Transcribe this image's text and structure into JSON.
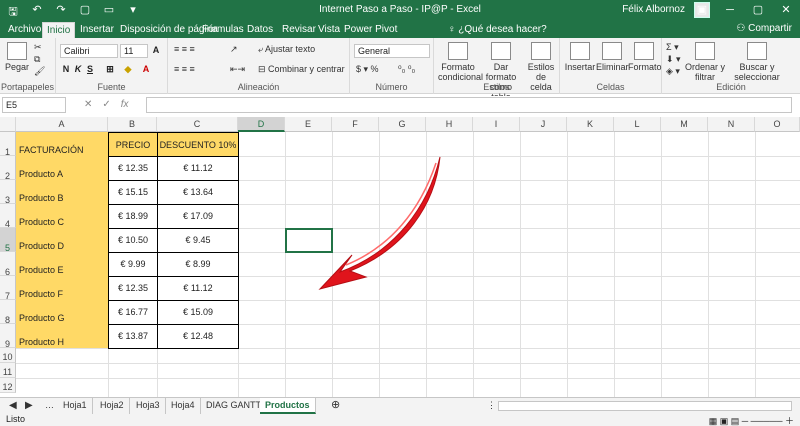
{
  "titlebar": {
    "title": "Internet Paso a Paso - IP@P  -  Excel",
    "user": "Félix Albornoz"
  },
  "tabs": [
    "Archivo",
    "Inicio",
    "Insertar",
    "Disposición de página",
    "Fórmulas",
    "Datos",
    "Revisar",
    "Vista",
    "Power Pivot"
  ],
  "tell_me": "¿Qué desea hacer?",
  "share": "Compartir",
  "ribbon": {
    "paste": "Pegar",
    "font_name": "Calibri",
    "font_size": "11",
    "wrap_text": "Ajustar texto",
    "merge_center": "Combinar y centrar",
    "number_format": "General",
    "cond_format": "Formato condicional",
    "table_format": "Dar formato como tabla",
    "cell_styles": "Estilos de celda",
    "insert": "Insertar",
    "delete": "Eliminar",
    "format": "Formato",
    "sort_filter": "Ordenar y filtrar",
    "find_select": "Buscar y seleccionar",
    "groups": {
      "clipboard": "Portapapeles",
      "font": "Fuente",
      "alignment": "Alineación",
      "number": "Número",
      "styles": "Estilos",
      "cells": "Celdas",
      "editing": "Edición"
    }
  },
  "formula_bar": {
    "name_box": "E5",
    "content": ""
  },
  "columns": [
    "A",
    "B",
    "C",
    "D",
    "E",
    "F",
    "G",
    "H",
    "I",
    "J",
    "K",
    "L",
    "M",
    "N",
    "O"
  ],
  "selected_column": "E",
  "selected_row": "5",
  "rows": [
    "1",
    "2",
    "3",
    "4",
    "5",
    "6",
    "7",
    "8",
    "9",
    "10",
    "11",
    "12"
  ],
  "table": {
    "headers": [
      "FACTURACIÓN",
      "PRECIO",
      "DESCUENTO 10%"
    ],
    "products": [
      "Producto A",
      "Producto B",
      "Producto C",
      "Producto D",
      "Producto E",
      "Producto F",
      "Producto G",
      "Producto H"
    ],
    "prices": [
      "€ 12.35",
      "€ 15.15",
      "€ 18.99",
      "€ 10.50",
      "€ 9.99",
      "€ 12.35",
      "€ 16.77",
      "€ 13.87"
    ],
    "discounts": [
      "€ 11.12",
      "€ 13.64",
      "€ 17.09",
      "€ 9.45",
      "€ 8.99",
      "€ 11.12",
      "€ 15.09",
      "€ 12.48"
    ]
  },
  "sheets": [
    "Hoja1",
    "Hoja2",
    "Hoja3",
    "Hoja4",
    "DIAG GANTT",
    "Productos"
  ],
  "active_sheet": "Productos",
  "status": {
    "mode": "Listo"
  },
  "colors": {
    "excel_green": "#217346",
    "highlight_yellow": "#ffd966",
    "arrow_red": "#e0141c"
  }
}
